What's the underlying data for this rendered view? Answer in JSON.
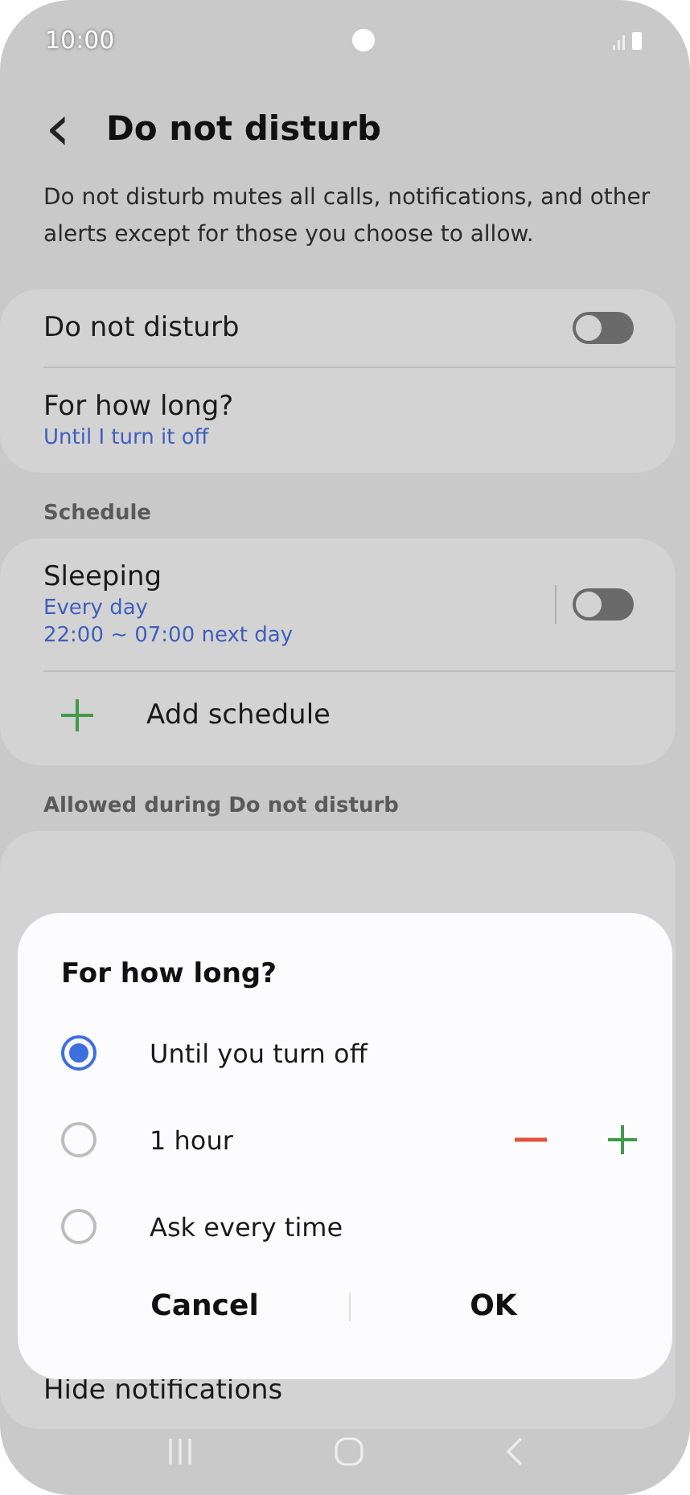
{
  "status_bar": {
    "time": "10:00"
  },
  "header": {
    "back_icon": "‹",
    "title": "Do not disturb"
  },
  "description": "Do not disturb mutes all calls, notifications, and other alerts except for those you choose to allow.",
  "main_card": {
    "toggle_label": "Do not disturb",
    "on": false,
    "duration_label": "For how long?",
    "duration_value": "Until I turn it off"
  },
  "schedule_section": {
    "heading": "Schedule",
    "schedules": [
      {
        "name": "Sleeping",
        "days": "Every day",
        "time": "22:00 ~ 07:00 next day",
        "on": false
      }
    ],
    "add_label": "Add schedule"
  },
  "allowed_section": {
    "heading": "Allowed during Do not disturb",
    "partial_item": "Hide notifications"
  },
  "dialog": {
    "title": "For how long?",
    "options": [
      {
        "label": "Until you turn off",
        "selected": true,
        "kind": "plain"
      },
      {
        "label": "1 hour",
        "selected": false,
        "kind": "stepper"
      },
      {
        "label": "Ask every time",
        "selected": false,
        "kind": "plain"
      }
    ],
    "buttons": [
      "Cancel",
      "OK"
    ]
  }
}
